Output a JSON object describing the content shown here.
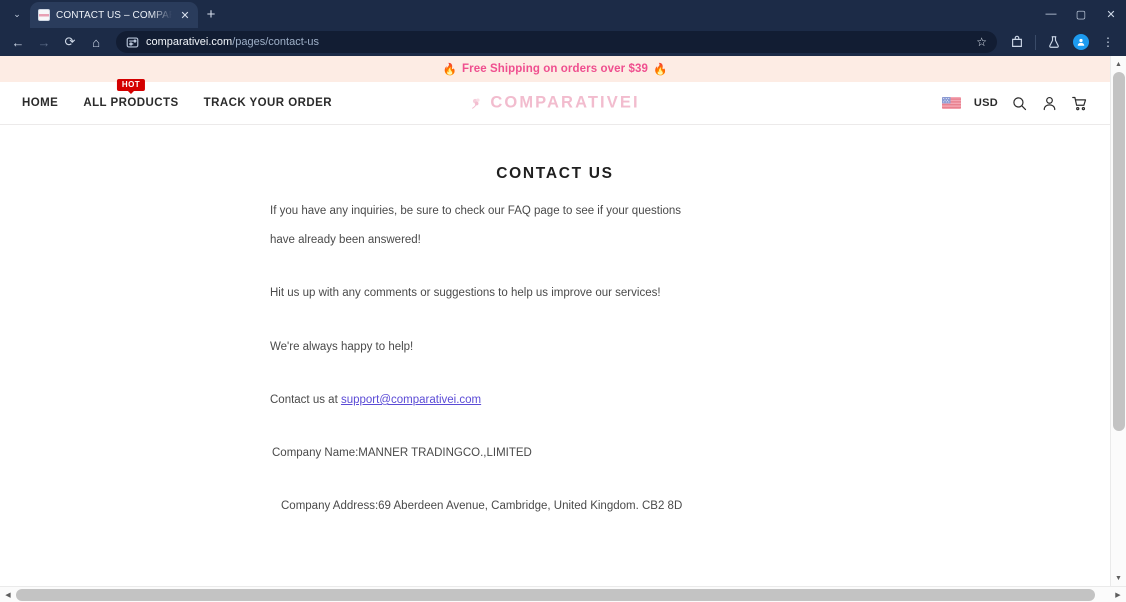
{
  "browser": {
    "tab": {
      "title": "CONTACT US – COMPARATIVEI",
      "favicon_name": "site-favicon",
      "close_label": "✕"
    },
    "new_tab_label": "+",
    "tab_list_chevron": "⌄",
    "window_controls": {
      "minimize": "—",
      "maximize": "▢",
      "close": "✕"
    },
    "nav": {
      "back": "←",
      "forward": "→",
      "reload": "⟳",
      "home": "⌂"
    },
    "omnibox": {
      "site_settings_icon": "page-settings-icon",
      "domain": "comparativei.com",
      "path": "/pages/contact-us",
      "bookmark_star": "☆"
    },
    "toolbar_icons": [
      "extensions-icon",
      "split-view-icon",
      "lab-flask-icon",
      "profile-avatar",
      "chrome-menu-icon"
    ],
    "menu_label": "⋮"
  },
  "site": {
    "announcement": {
      "left_emoji": "🔥",
      "text": "Free Shipping on orders over $39",
      "right_emoji": "🔥",
      "background": "#fdece4",
      "color": "#ef4f8f"
    },
    "nav_items": [
      {
        "label": "HOME",
        "badge": null
      },
      {
        "label": "ALL PRODUCTS",
        "badge": "HOT"
      },
      {
        "label": "TRACK YOUR ORDER",
        "badge": null
      }
    ],
    "logo": {
      "text": "COMPARATIVEI",
      "mark": "floral-mark",
      "color": "#f2bcce"
    },
    "header_right": {
      "flag": "us-flag",
      "currency": "USD",
      "icons": [
        "search-icon",
        "account-icon",
        "cart-icon"
      ]
    }
  },
  "main": {
    "title": "CONTACT US",
    "paragraphs": [
      "If you have any inquiries, be sure to check our FAQ page to see if your questions",
      "have already been answered!",
      "Hit us up with any comments or suggestions to help us improve our services!",
      "We're always happy to help!"
    ],
    "contact_line": {
      "prefix": "Contact us at ",
      "email": "support@comparativei.com"
    },
    "company_name": "Company Name:MANNER TRADINGCO.,LIMITED",
    "company_address": "Company Address:69 Aberdeen Avenue, Cambridge, United Kingdom. CB2 8D"
  },
  "scrollbars": {
    "v_up": "▲",
    "v_down": "▼",
    "h_left": "◀",
    "h_right": "▶"
  }
}
